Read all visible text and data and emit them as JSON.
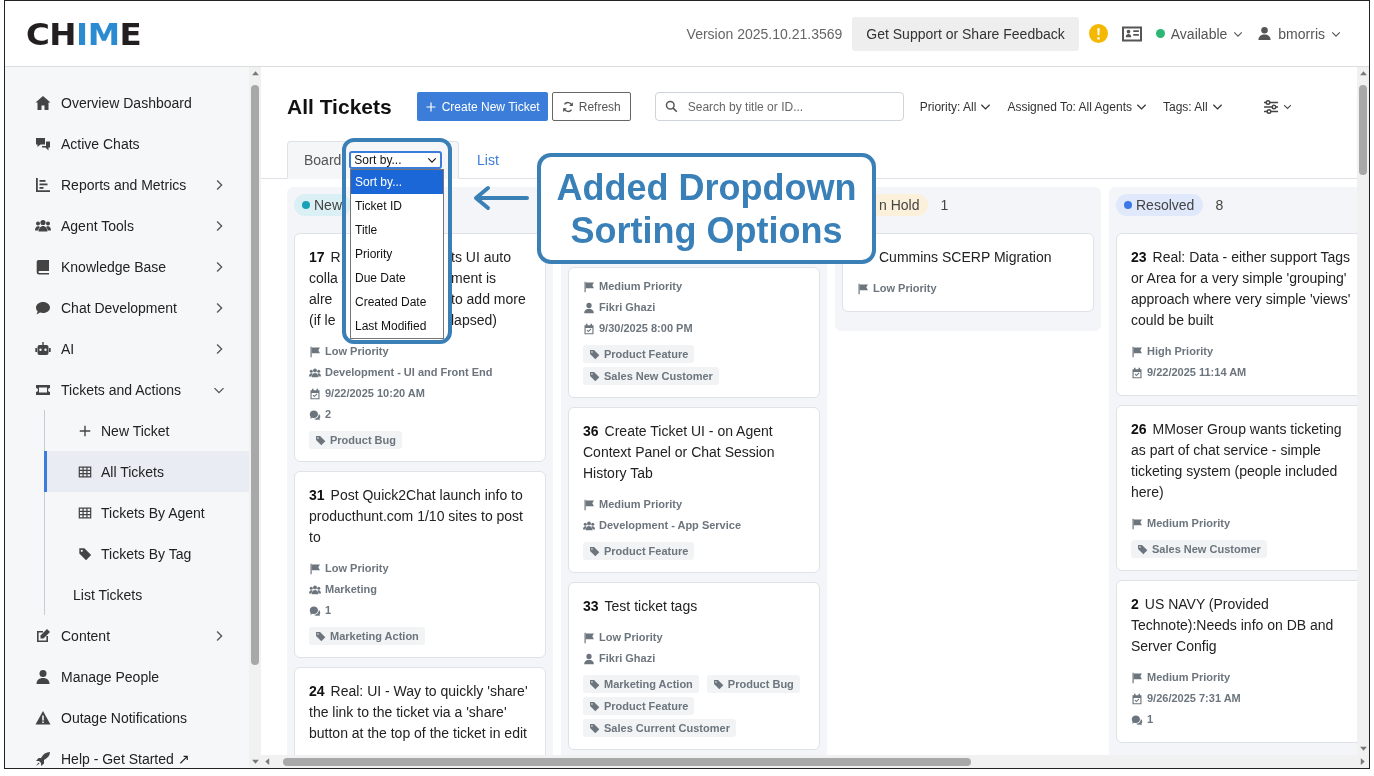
{
  "header": {
    "logo_parts": [
      {
        "text": "CH",
        "accent": false
      },
      {
        "text": "IM",
        "accent": true
      },
      {
        "text": "E",
        "accent": false
      }
    ],
    "version": "Version 2025.10.21.3569",
    "support_button": "Get Support or Share Feedback",
    "status": {
      "label": "Available",
      "color": "#2bb673"
    },
    "user": "bmorris"
  },
  "sidebar": {
    "items": [
      {
        "kind": "link",
        "label": "Overview Dashboard",
        "selected": false
      },
      {
        "kind": "link",
        "label": "Active Chats",
        "selected": false
      },
      {
        "kind": "group",
        "label": "Reports and Metrics",
        "selected": false,
        "expanded": false
      },
      {
        "kind": "group",
        "label": "Agent Tools",
        "selected": false,
        "expanded": false
      },
      {
        "kind": "group",
        "label": "Knowledge Base",
        "selected": false,
        "expanded": false
      },
      {
        "kind": "group",
        "label": "Chat Development",
        "selected": false,
        "expanded": false
      },
      {
        "kind": "group",
        "label": "AI",
        "selected": false,
        "expanded": false
      },
      {
        "kind": "group",
        "label": "Tickets and Actions",
        "selected": false,
        "expanded": true,
        "children": [
          {
            "kind": "link",
            "label": "New Ticket",
            "selected": false
          },
          {
            "kind": "link",
            "label": "All Tickets",
            "selected": true
          },
          {
            "kind": "link",
            "label": "Tickets By Agent",
            "selected": false
          },
          {
            "kind": "link",
            "label": "Tickets By Tag",
            "selected": false
          },
          {
            "kind": "link",
            "label": "List Tickets",
            "selected": false
          }
        ]
      },
      {
        "kind": "group",
        "label": "Content",
        "selected": false,
        "expanded": false
      },
      {
        "kind": "link",
        "label": "Manage People",
        "selected": false
      },
      {
        "kind": "link",
        "label": "Outage Notifications",
        "selected": false
      },
      {
        "kind": "link",
        "label": "Help - Get Started ↗",
        "selected": false
      }
    ]
  },
  "toolbar": {
    "title": "All Tickets",
    "create_button": "Create New Ticket",
    "refresh_button": "Refresh",
    "search": {
      "placeholder": "Search by title or ID..."
    },
    "filters": [
      "Priority: All",
      "Assigned To: All Agents",
      "Tags: All"
    ]
  },
  "tabs": [
    {
      "label": "Board",
      "selected": true
    },
    {
      "label": "List",
      "selected": false
    }
  ],
  "sort_select": {
    "value": "Sort by...",
    "options": [
      {
        "label": "Sort by...",
        "selected": true
      },
      {
        "label": "Ticket ID",
        "selected": false
      },
      {
        "label": "Title",
        "selected": false
      },
      {
        "label": "Priority",
        "selected": false
      },
      {
        "label": "Due Date",
        "selected": false
      },
      {
        "label": "Created Date",
        "selected": false
      },
      {
        "label": "Last Modified",
        "selected": false
      }
    ]
  },
  "columns": [
    {
      "label": "New",
      "color": "#17a2b8",
      "dot": true,
      "cards": [
        {
          "id": "17",
          "title_fragments": [
            [
              "R",
              "ts UI auto"
            ],
            [
              "colla",
              "ment is"
            ],
            [
              "alre",
              "to add more"
            ],
            [
              "(if le",
              "lapsed)"
            ]
          ],
          "meta": [
            {
              "kind": "priority",
              "text": "Low Priority"
            },
            {
              "kind": "team",
              "text": "Development - UI and Front End"
            },
            {
              "kind": "due",
              "text": "9/22/2025 10:20 AM"
            },
            {
              "kind": "comments",
              "text": "2"
            }
          ],
          "tags": [
            "Product Bug"
          ]
        },
        {
          "id": "31",
          "title": "Post Quick2Chat launch info to producthunt.com 1/10 sites to post to",
          "meta": [
            {
              "kind": "priority",
              "text": "Low Priority"
            },
            {
              "kind": "team",
              "text": "Marketing"
            },
            {
              "kind": "comments",
              "text": "1"
            }
          ],
          "tags": [
            "Marketing Action"
          ]
        },
        {
          "id": "24",
          "title": "Real: UI - Way to quickly 'share' the link to the ticket via a 'share' button at the top of the ticket in edit"
        }
      ]
    },
    {
      "cards": [
        {
          "meta": [
            {
              "kind": "priority",
              "text": "Medium Priority"
            },
            {
              "kind": "assignee",
              "text": "Fikri Ghazi"
            },
            {
              "kind": "due",
              "text": "9/30/2025 8:00 PM"
            }
          ],
          "tags": [
            "Product Feature",
            "Sales New Customer"
          ]
        },
        {
          "id": "36",
          "title": "Create Ticket UI - on Agent Context Panel or Chat Session History Tab",
          "meta": [
            {
              "kind": "priority",
              "text": "Medium Priority"
            },
            {
              "kind": "team",
              "text": "Development - App Service"
            }
          ],
          "tags": [
            "Product Feature"
          ]
        },
        {
          "id": "33",
          "title": "Test ticket tags",
          "meta": [
            {
              "kind": "priority",
              "text": "Low Priority"
            },
            {
              "kind": "assignee",
              "text": "Fikri Ghazi"
            }
          ],
          "tags": [
            "Marketing Action",
            "Product Bug",
            "Product Feature",
            "Sales Current Customer"
          ]
        }
      ]
    },
    {
      "label": "n Hold",
      "count": "1",
      "color": "#fbf0da",
      "dot": false,
      "cards": [
        {
          "title": "Cummins SCERP Migration",
          "meta": [
            {
              "kind": "priority",
              "text": "Low Priority"
            }
          ]
        }
      ]
    },
    {
      "label": "Resolved",
      "count": "8",
      "color": "#3b78e7",
      "dot": true,
      "cards": [
        {
          "id": "23",
          "title": "Real: Data - either support Tags or Area for a very simple 'grouping' approach where very simple 'views' could be built",
          "meta": [
            {
              "kind": "priority",
              "text": "High Priority"
            },
            {
              "kind": "due",
              "text": "9/22/2025 11:14 AM"
            }
          ]
        },
        {
          "id": "26",
          "title": "MMoser Group wants ticketing as part of chat service - simple ticketing system (people included here)",
          "meta": [
            {
              "kind": "priority",
              "text": "Medium Priority"
            }
          ],
          "tags": [
            "Sales New Customer"
          ]
        },
        {
          "id": "2",
          "title": "US NAVY (Provided Technote):Needs info on DB and Server Config",
          "meta": [
            {
              "kind": "priority",
              "text": "Medium Priority"
            },
            {
              "kind": "due",
              "text": "9/26/2025 7:31 AM"
            },
            {
              "kind": "comments",
              "text": "1"
            }
          ]
        }
      ]
    }
  ],
  "callout": {
    "text": "Added Dropdown Sorting Options"
  }
}
